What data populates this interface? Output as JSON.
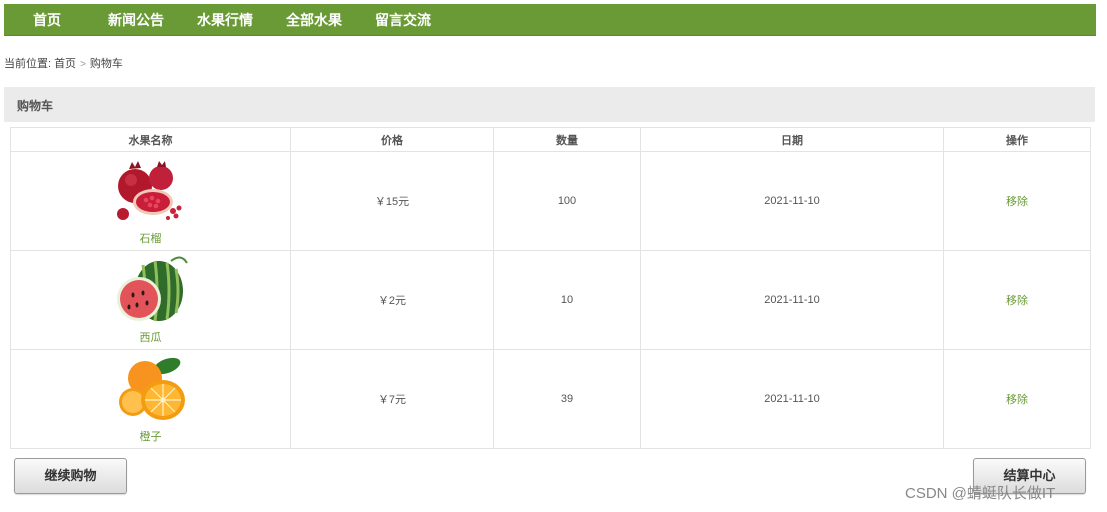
{
  "nav": {
    "items": [
      "首页",
      "新闻公告",
      "水果行情",
      "全部水果",
      "留言交流"
    ]
  },
  "breadcrumb": {
    "prefix": "当前位置:",
    "home": "首页",
    "current": "购物车"
  },
  "section": {
    "title": "购物车"
  },
  "table": {
    "headers": [
      "水果名称",
      "价格",
      "数量",
      "日期",
      "操作"
    ],
    "rows": [
      {
        "name": "石榴",
        "price": "￥15元",
        "qty": "100",
        "date": "2021-11-10",
        "action": "移除",
        "icon": "pomegranate-image"
      },
      {
        "name": "西瓜",
        "price": "￥2元",
        "qty": "10",
        "date": "2021-11-10",
        "action": "移除",
        "icon": "watermelon-image"
      },
      {
        "name": "橙子",
        "price": "￥7元",
        "qty": "39",
        "date": "2021-11-10",
        "action": "移除",
        "icon": "orange-image"
      }
    ]
  },
  "buttons": {
    "continue": "继续购物",
    "checkout": "结算中心"
  },
  "watermark": "CSDN @蜻蜓队长做IT",
  "colors": {
    "nav_bg": "#6a9a36",
    "accent_text": "#6a9a36",
    "section_bg": "#ebebeb"
  }
}
